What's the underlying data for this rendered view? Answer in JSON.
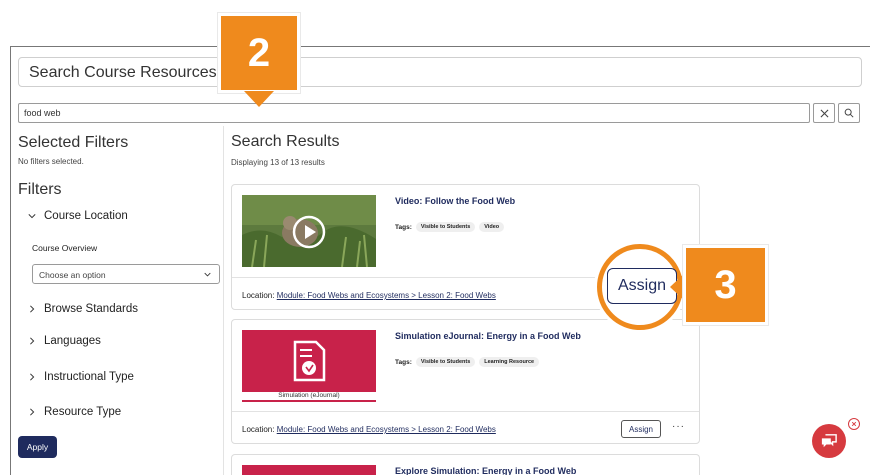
{
  "header": {
    "title": "Search Course Resources"
  },
  "search": {
    "value": "food web"
  },
  "sidebar": {
    "selected_filters_heading": "Selected Filters",
    "no_filters_text": "No filters selected.",
    "filters_heading": "Filters",
    "course_location": {
      "label": "Course Location",
      "sub_label": "Course Overview",
      "select_placeholder": "Choose an option"
    },
    "items": [
      {
        "label": "Browse Standards"
      },
      {
        "label": "Languages"
      },
      {
        "label": "Instructional Type"
      },
      {
        "label": "Resource Type"
      }
    ],
    "apply_label": "Apply"
  },
  "results": {
    "heading": "Search Results",
    "count_text": "Displaying 13 of 13 results",
    "cards": [
      {
        "title": "Video: Follow the Food Web",
        "tags_label": "Tags:",
        "tags": [
          "Visible to Students",
          "Video"
        ],
        "location_prefix": "Location:",
        "location_link": "Module: Food Webs and Ecosystems > Lesson 2: Food Webs",
        "assign_label": "Assign"
      },
      {
        "title": "Simulation eJournal: Energy in a Food Web",
        "thumb_caption": "Simulation (eJournal)",
        "tags_label": "Tags:",
        "tags": [
          "Visible to Students",
          "Learning Resource"
        ],
        "location_prefix": "Location:",
        "location_link": "Module: Food Webs and Ecosystems > Lesson 2: Food Webs",
        "assign_label": "Assign",
        "more_label": "···"
      },
      {
        "title": "Explore Simulation: Energy in a Food Web"
      }
    ]
  },
  "callouts": {
    "step2": "2",
    "step3": "3",
    "assign_zoom_label": "Assign"
  },
  "colors": {
    "accent_orange": "#ef8a1d",
    "navy": "#1f2b5e",
    "chat_red": "#d63a3f",
    "thumb_red": "#c8224a"
  },
  "icons": [
    "close-icon",
    "search-icon",
    "chevron-down-icon",
    "chevron-right-icon",
    "play-icon",
    "document-icon",
    "chat-icon"
  ]
}
